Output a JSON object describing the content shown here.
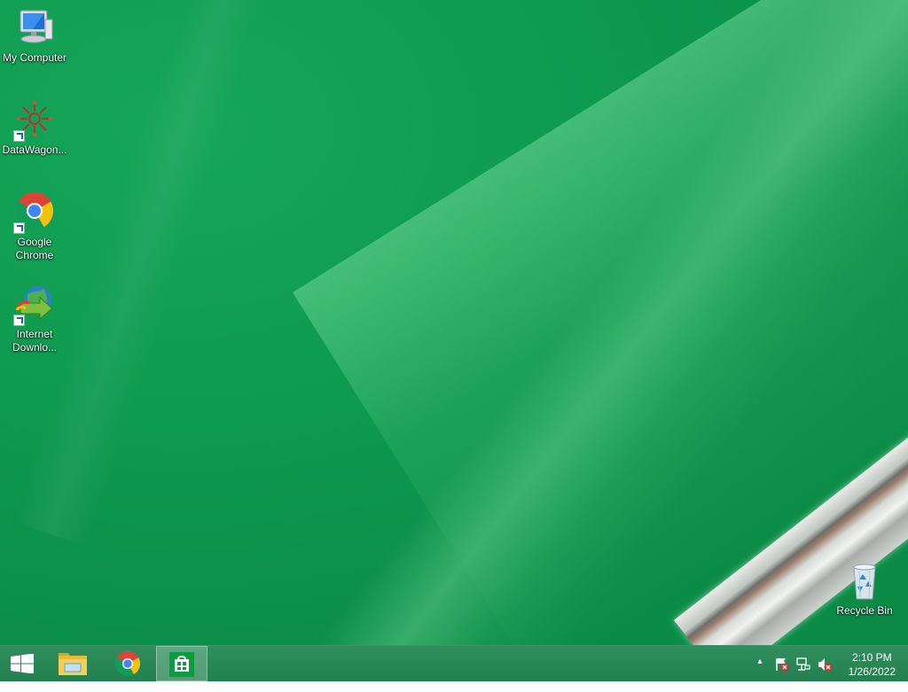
{
  "desktop": {
    "icons": [
      {
        "label": "My Computer",
        "icon": "computer-icon"
      },
      {
        "label": "DataWagon...",
        "icon": "datawagon-icon"
      },
      {
        "label_line1": "Google",
        "label_line2": "Chrome",
        "icon": "chrome-icon"
      },
      {
        "label_line1": "Internet",
        "label_line2": "Downlo...",
        "icon": "internet-download-manager-icon"
      },
      {
        "label": "Recycle Bin",
        "icon": "recycle-bin-icon"
      }
    ]
  },
  "taskbar": {
    "buttons": [
      {
        "name": "start",
        "icon": "windows-logo-icon"
      },
      {
        "name": "file-explorer",
        "icon": "folder-icon"
      },
      {
        "name": "google-chrome",
        "icon": "chrome-icon"
      },
      {
        "name": "store",
        "icon": "store-icon"
      }
    ],
    "tray": {
      "overflow_arrow": "▲",
      "icons": [
        "action-center-flag-icon",
        "network-icon",
        "volume-muted-icon"
      ]
    },
    "clock": {
      "time": "2:10 PM",
      "date": "1/26/2022"
    }
  },
  "colors": {
    "desktop_green": "#0e9a4f",
    "taskbar_green": "#237f4f"
  }
}
